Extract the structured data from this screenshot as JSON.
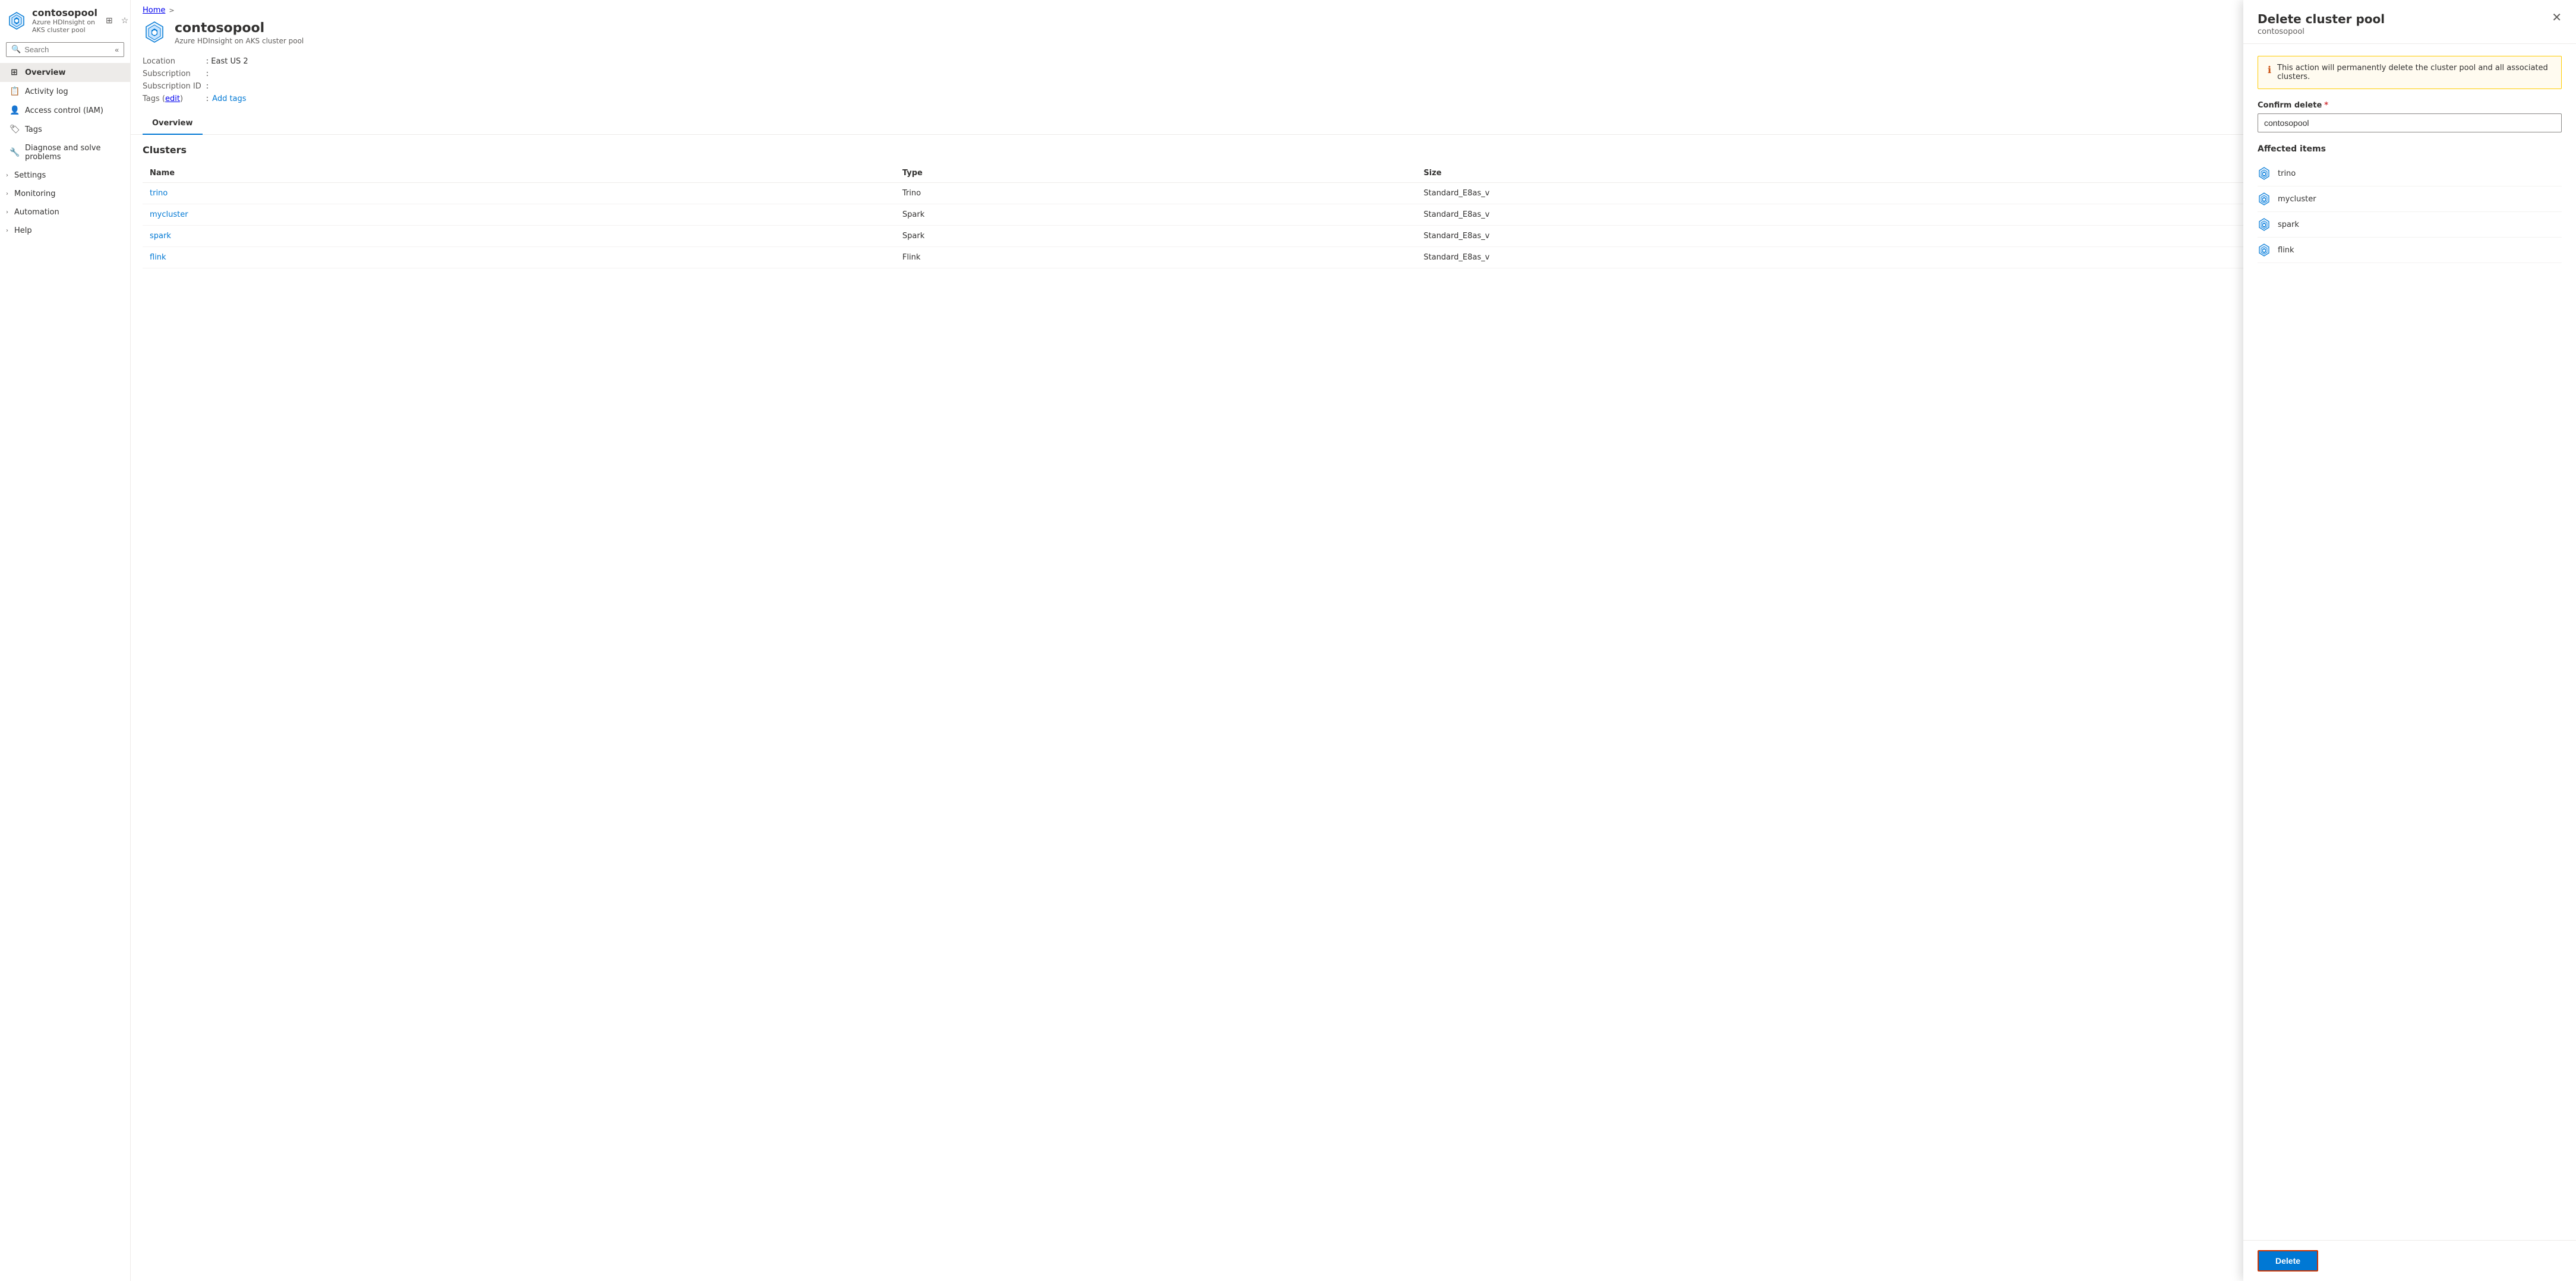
{
  "breadcrumb": {
    "home": "Home",
    "sep": ">"
  },
  "sidebar": {
    "app_title": "contosopool",
    "app_subtitle": "Azure HDInsight on AKS cluster pool",
    "search_placeholder": "Search",
    "nav_items": [
      {
        "id": "overview",
        "label": "Overview",
        "icon": "⊞",
        "active": true,
        "expandable": false
      },
      {
        "id": "activity-log",
        "label": "Activity log",
        "icon": "📋",
        "active": false,
        "expandable": false
      },
      {
        "id": "access-control",
        "label": "Access control (IAM)",
        "icon": "👤",
        "active": false,
        "expandable": false
      },
      {
        "id": "tags",
        "label": "Tags",
        "icon": "🏷",
        "active": false,
        "expandable": false
      },
      {
        "id": "diagnose",
        "label": "Diagnose and solve problems",
        "icon": "🔧",
        "active": false,
        "expandable": false
      },
      {
        "id": "settings",
        "label": "Settings",
        "icon": "",
        "active": false,
        "expandable": true
      },
      {
        "id": "monitoring",
        "label": "Monitoring",
        "icon": "",
        "active": false,
        "expandable": true
      },
      {
        "id": "automation",
        "label": "Automation",
        "icon": "",
        "active": false,
        "expandable": true
      },
      {
        "id": "help",
        "label": "Help",
        "icon": "",
        "active": false,
        "expandable": true
      }
    ]
  },
  "main": {
    "title": "contosopool",
    "subtitle": "Azure HDInsight on AKS cluster pool",
    "meta": [
      {
        "label": "Location",
        "value": ": East US 2"
      },
      {
        "label": "Subscription",
        "value": ":"
      },
      {
        "label": "Subscription ID",
        "value": ":"
      },
      {
        "label": "Tags (edit)",
        "value": ": Add tags"
      }
    ],
    "tab": "Overview",
    "clusters_section_title": "Clusters",
    "table_headers": [
      "Name",
      "Type",
      "Size"
    ],
    "clusters": [
      {
        "name": "trino",
        "type": "Trino",
        "size": "Standard_E8as_v"
      },
      {
        "name": "mycluster",
        "type": "Spark",
        "size": "Standard_E8as_v"
      },
      {
        "name": "spark",
        "type": "Spark",
        "size": "Standard_E8as_v"
      },
      {
        "name": "flink",
        "type": "Flink",
        "size": "Standard_E8as_v"
      }
    ]
  },
  "delete_panel": {
    "title": "Delete cluster pool",
    "subtitle": "contosopool",
    "warning_text": "This action will permanently delete the cluster pool and all associated clusters.",
    "confirm_label": "Confirm delete",
    "confirm_placeholder": "",
    "confirm_value": "contosopool",
    "affected_title": "Affected items",
    "affected_items": [
      {
        "name": "trino"
      },
      {
        "name": "mycluster"
      },
      {
        "name": "spark"
      },
      {
        "name": "flink"
      }
    ],
    "delete_button_label": "Delete"
  }
}
